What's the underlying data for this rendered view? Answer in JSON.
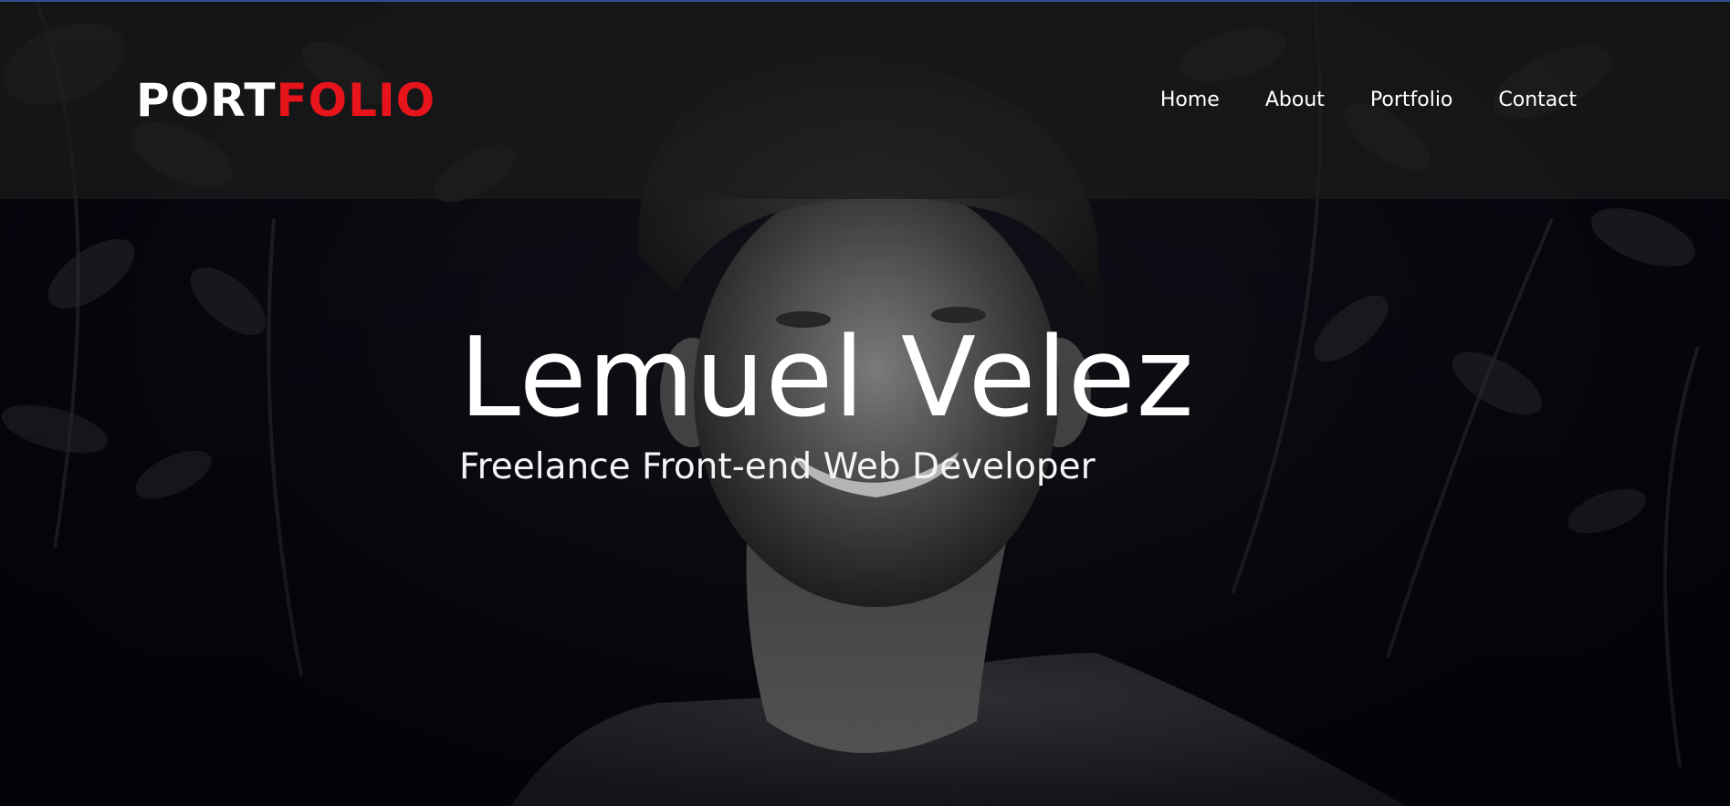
{
  "brand": {
    "logo_part1": "PORT",
    "logo_part2": "FOLIO",
    "accent_color": "#e8141c"
  },
  "nav": {
    "items": [
      {
        "label": "Home"
      },
      {
        "label": "About"
      },
      {
        "label": "Portfolio"
      },
      {
        "label": "Contact"
      }
    ]
  },
  "hero": {
    "name": "Lemuel Velez",
    "subtitle": "Freelance Front-end Web Developer",
    "background": "black-and-white portrait photo"
  }
}
